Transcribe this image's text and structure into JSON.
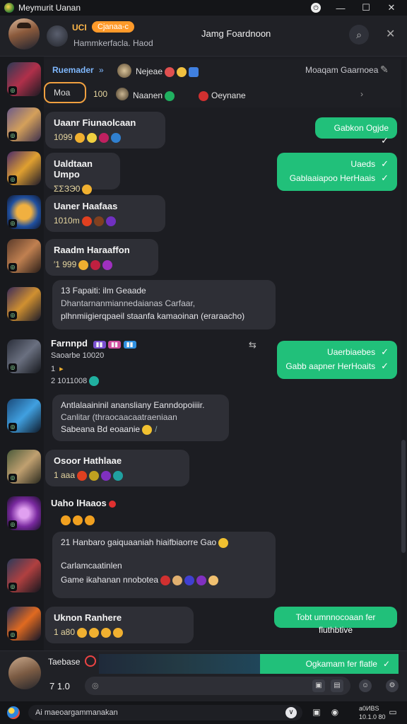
{
  "window": {
    "title": "Mеymurit Uаnan"
  },
  "header": {
    "tag1": "UCI",
    "tag2": "Cjanaa-c",
    "subtitle": "Hammkerfacla. Haod",
    "center_title": "Jamg Fоаrdnoon"
  },
  "top_row": {
    "label": "Ruemader",
    "arrow": "»",
    "user": "Nejeae",
    "right": "Moaqam Gaarnoea",
    "pill": "Moa",
    "num": "100",
    "name2": "Naanen",
    "name3": "Oeynane",
    "chevron": "›"
  },
  "messages": [
    {
      "name": "Uaanr Fiunaolcaan",
      "meta": "1099"
    },
    {
      "name": "Ualdtaan Umpo",
      "meta": "ΣΣЗЭ0"
    },
    {
      "name": "Uaner Haafaas",
      "meta": "1010m"
    },
    {
      "name": "Raadm Haraaffon",
      "meta": "′1 999"
    },
    {
      "line1": "13  Fapaiti: ilm Geaade",
      "line2": "Dhantarnanmiannedaianas Carfaar,",
      "line3": "plhnmiigierqpaeil staanfa kamaoinan (eraraacho)"
    },
    {
      "name": "Farnnpd",
      "meta": "Saoarbe 10020",
      "line1": "1",
      "line2": "2  1011008"
    },
    {
      "line1": "Antlalaaininil anansliany Eanndopoiiiir.",
      "line2": "Canlitar (thraocaacaatraeniaan",
      "line3": "Sabeana Bd eoaanie"
    },
    {
      "name": "Osoor Hathlaae",
      "meta": "1 aaa"
    },
    {
      "name": "Uaho lHaaos"
    },
    {
      "line1": "21   Hanbaro gaiquaaniah hiaifbiaorre  Gao",
      "line2": "Carlamcaatinlen",
      "line3": "Game ikahanan nnobotea"
    },
    {
      "name": "Uknon Ranhere",
      "meta": "1 a80"
    }
  ],
  "outgoing": [
    {
      "text": "Gabkon Ogjde"
    },
    {
      "text": "Uaeds"
    },
    {
      "text": "Gablaaiapoo HerHaais"
    },
    {
      "text": "Uaerbiaebes"
    },
    {
      "text": "Gabb aapner HerHoaits"
    },
    {
      "text": "Tobt umnnocoaan fer fluthbtive"
    }
  ],
  "composer": {
    "label": "Taebase",
    "nums": "7   1.0",
    "green": "Ogkamam fer flatle"
  },
  "bottom": {
    "search": "Ai maeoаrgаmmanakan",
    "time1": "a0ИBS",
    "time2": "10.1.0 80"
  },
  "colors": {
    "accent_green": "#21c07a",
    "bg": "#1c1d22",
    "bubble": "#2e2f36",
    "orange": "#ff9a2a"
  }
}
